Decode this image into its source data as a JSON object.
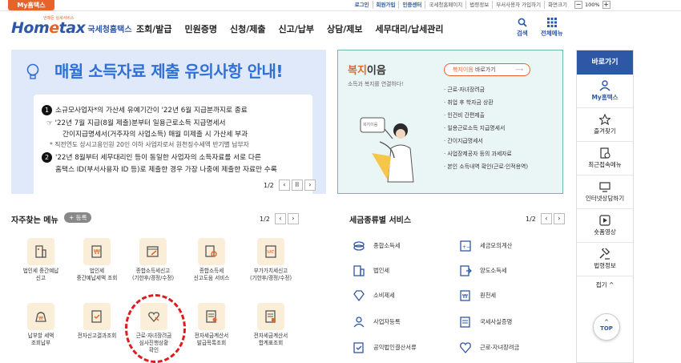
{
  "topbar": {
    "my_hometax": "My홈택스",
    "links": [
      "로그인",
      "회원가입",
      "인증센터",
      "국세청홈페이지",
      "법령정보",
      "부서사용자 가입하기",
      "화면크기"
    ],
    "zoom_minus": "−",
    "zoom_value": "100%",
    "zoom_plus": "+"
  },
  "header": {
    "logo_tag": "언제든 실세서비스",
    "logo_home": "Hom",
    "logo_e": "e",
    "logo_tax": "tax",
    "logo_sub": "국세청홈택스",
    "nav": [
      "조회/발급",
      "민원증명",
      "신청/제출",
      "신고/납부",
      "상담/제보",
      "세무대리/납세관리"
    ],
    "search_label": "검색",
    "allmenu_label": "전체메뉴"
  },
  "banner": {
    "title": "매월 소득자료 제출 유의사항 안내!",
    "item1_num": "1",
    "item1": "소규모사업자*의 가산세 유예기간이 '22년 6월 지급분까지로 종료",
    "item1_sub1": "'22년 7월 지급(8월 제출)분부터 일용근로소득 지급명세서",
    "item1_sub2": "간이지급명세서(거주자의 사업소득) 매월 미제출 시 가산세 부과",
    "item1_note": "* 직전연도 상시고용인원 20인 이하 사업자로서 원천징수세액 반기별 납부자",
    "item2_num": "2",
    "item2_line1": "'22년 8월부터 세무대리인 등이 동일한 사업자의 소득자료를 서로 다른",
    "item2_line2": "홈택스 ID(부서사용자 ID 등)로 제출한 경우 가장 나중에 제출한 자료만 수록",
    "pager": "1/2"
  },
  "bokji": {
    "title_accent": "복지",
    "title_rest": "이음",
    "subtitle": "소득과 복지를 연결하다!",
    "button_accent": "복지이음",
    "button_rest": " 바로가기",
    "items": [
      "근로·자녀장려금",
      "취업 후 학자금 상환",
      "인건비 간편제출",
      "일용근로소득 지급명세서",
      "간이지급명세서",
      "사업장제공자 등의 과세자료",
      "본인 소득내역 확인(근로·인적용역)"
    ],
    "sign": "복지이음"
  },
  "frequent": {
    "title": "자주찾는 메뉴",
    "add_label": "등록",
    "pager": "1/2",
    "items": [
      {
        "l1": "법인세 중간예납",
        "l2": "신고"
      },
      {
        "l1": "법인세",
        "l2": "중간예납세액 조회"
      },
      {
        "l1": "종합소득세신고",
        "l2": "(기한후/경정/수정)"
      },
      {
        "l1": "종합소득세",
        "l2": "신고도움 서비스"
      },
      {
        "l1": "부가가치세신고",
        "l2": "(기한후/경정/수정)"
      },
      {
        "l1": "납부할 세액",
        "l2": "조회납부"
      },
      {
        "l1": "전자신고결과조회",
        "l2": ""
      },
      {
        "l1": "근로·자녀장려금",
        "l2": "심사진행상황",
        "l3": "확인"
      },
      {
        "l1": "전자세금계산서",
        "l2": "발급목록조회"
      },
      {
        "l1": "전자세금계산서",
        "l2": "합계표조회"
      }
    ]
  },
  "taxservice": {
    "title": "세금종류별 서비스",
    "pager": "1/2",
    "items": [
      "종합소득세",
      "세금모의계산",
      "법인세",
      "양도소득세",
      "소비제세",
      "원천세",
      "사업자등록",
      "국세사실증명",
      "공익법인결산서류",
      "근로·자녀장려금"
    ]
  },
  "quick": {
    "head": "바로가기",
    "items": [
      "My홈택스",
      "즐겨찾기",
      "최근접속메뉴",
      "인터넷상담하기",
      "숏폼영상",
      "법령정보"
    ],
    "fold": "접기 ^",
    "top": "TOP"
  },
  "colors": {
    "brand": "#2e57a5",
    "accent": "#e8632b",
    "highlight": "#e01b1b"
  }
}
